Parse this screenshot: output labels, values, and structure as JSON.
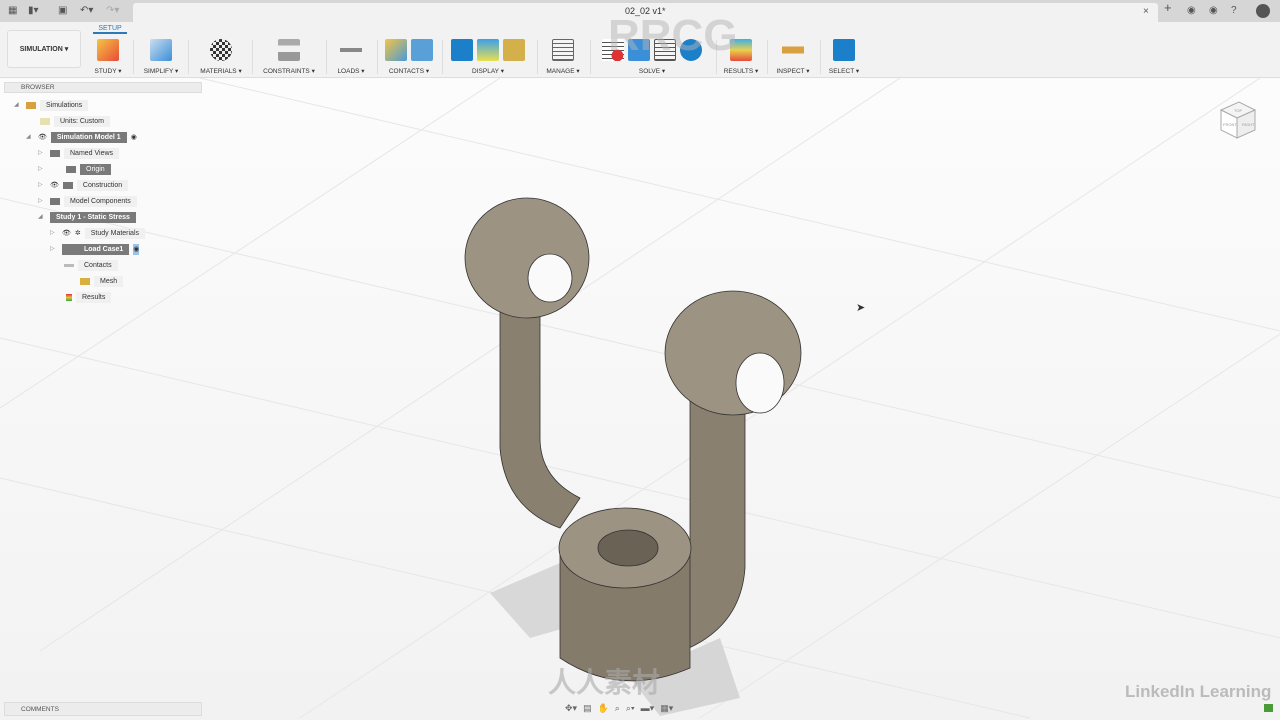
{
  "titlebar": {
    "document_title": "02_02 v1*"
  },
  "toolbar": {
    "workspace": "SIMULATION ▾",
    "active_tab": "SETUP",
    "groups": [
      {
        "label": "STUDY ▾"
      },
      {
        "label": "SIMPLIFY ▾"
      },
      {
        "label": "MATERIALS ▾"
      },
      {
        "label": "CONSTRAINTS ▾"
      },
      {
        "label": "LOADS ▾"
      },
      {
        "label": "CONTACTS ▾"
      },
      {
        "label": "DISPLAY ▾"
      },
      {
        "label": "MANAGE ▾"
      },
      {
        "label": "SOLVE ▾"
      },
      {
        "label": "RESULTS ▾"
      },
      {
        "label": "INSPECT ▾"
      },
      {
        "label": "SELECT ▾"
      }
    ]
  },
  "browser": {
    "title": "BROWSER",
    "items": [
      {
        "label": "Simulations"
      },
      {
        "label": "Units: Custom"
      },
      {
        "label": "Simulation Model 1"
      },
      {
        "label": "Named Views"
      },
      {
        "label": "Origin"
      },
      {
        "label": "Construction"
      },
      {
        "label": "Model Components"
      },
      {
        "label": "Study 1 - Static Stress"
      },
      {
        "label": "Study Materials"
      },
      {
        "label": "Load Case1"
      },
      {
        "label": "Contacts"
      },
      {
        "label": "Mesh"
      },
      {
        "label": "Results"
      }
    ]
  },
  "comments": {
    "title": "COMMENTS"
  },
  "viewcube": {
    "faces": [
      "TOP",
      "FRONT",
      "RIGHT"
    ]
  },
  "watermarks": {
    "rrcg": "RRCG",
    "bottom": "人人素材",
    "brand": "LinkedIn Learning"
  }
}
